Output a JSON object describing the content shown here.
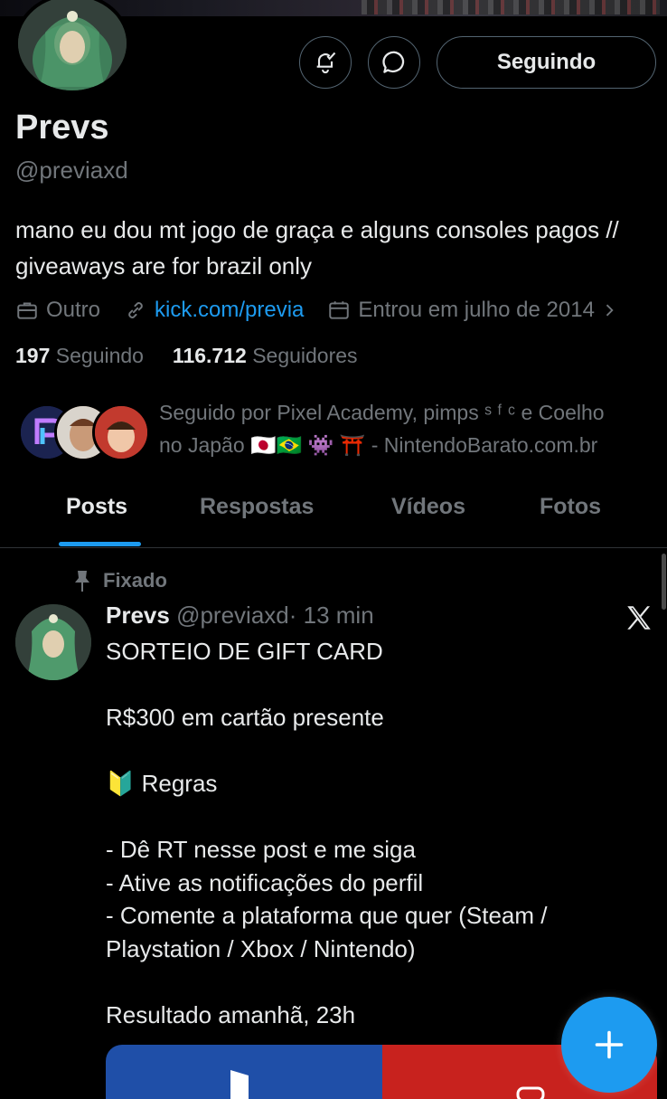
{
  "profile": {
    "name": "Prevs",
    "handle": "@previaxd",
    "bio": "mano eu dou mt jogo de graça e alguns consoles pagos // giveaways are for brazil only",
    "category": "Outro",
    "link": "kick.com/previa",
    "joined": "Entrou em julho de 2014",
    "following_count": "197",
    "following_label": "Seguindo",
    "followers_count": "116.712",
    "followers_label": "Seguidores",
    "followed_by_line1": "Seguido por Pixel Academy, pimps ˢ ᶠ ᶜ e Coelho",
    "followed_by_line2": "no Japão 🇯🇵🇧🇷 👾 ⛩️ - NintendoBarato.com.br"
  },
  "actions": {
    "notify_icon": "bell-check-icon",
    "message_icon": "message-icon",
    "follow_label": "Seguindo"
  },
  "tabs": [
    {
      "label": "Posts",
      "active": true
    },
    {
      "label": "Respostas",
      "active": false
    },
    {
      "label": "Vídeos",
      "active": false
    },
    {
      "label": "Fotos",
      "active": false
    }
  ],
  "post": {
    "pinned_label": "Fixado",
    "author_name": "Prevs",
    "author_handle": "@previaxd",
    "time": "· 13 min",
    "lines": [
      "SORTEIO DE GIFT CARD",
      "",
      "R$300 em cartão presente",
      "",
      "🔰 Regras",
      "",
      "- Dê RT nesse post e me siga",
      "- Ative as notificações do perfil",
      "- Comente a plataforma que quer (Steam / Playstation / Xbox / Nintendo)",
      "",
      "Resultado amanhã, 23h"
    ]
  },
  "colors": {
    "accent": "#1d9bf0",
    "text": "#e7e9ea",
    "muted": "#71767b",
    "border": "#536471"
  }
}
